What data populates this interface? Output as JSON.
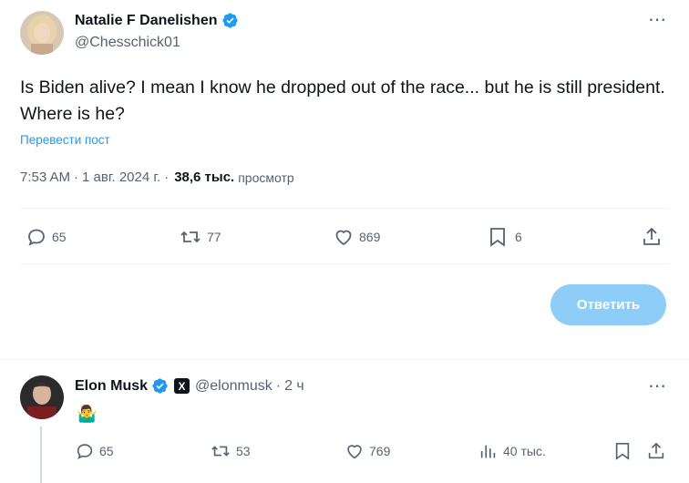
{
  "post": {
    "author_name": "Natalie F Danelishen",
    "author_handle": "@Chesschick01",
    "text": "Is Biden alive? I mean I know he dropped out of the race... but he is still president. Where is he?",
    "translate_link": "Перевести пост",
    "time": "7:53 AM",
    "sep1": "·",
    "date": "1 авг. 2024 г.",
    "sep2": "·",
    "views_count": "38,6 тыс.",
    "views_label": "просмотр",
    "more_icon": "⋯",
    "actions": {
      "replies": "65",
      "reposts": "77",
      "likes": "869",
      "bookmarks": "6"
    }
  },
  "reply_button": {
    "label": "Ответить"
  },
  "reply": {
    "author_name": "Elon Musk",
    "author_handle": "@elonmusk",
    "sep": "·",
    "time": "2 ч",
    "x_badge": "X",
    "text": "🤷‍♂️",
    "more_icon": "⋯",
    "actions": {
      "replies": "65",
      "reposts": "53",
      "likes": "769",
      "views": "40 тыс."
    }
  },
  "colors": {
    "accent": "#1d9bf0",
    "muted": "#536471",
    "reply_button_bg": "#8ecdf8",
    "divider": "#eff3f4"
  }
}
